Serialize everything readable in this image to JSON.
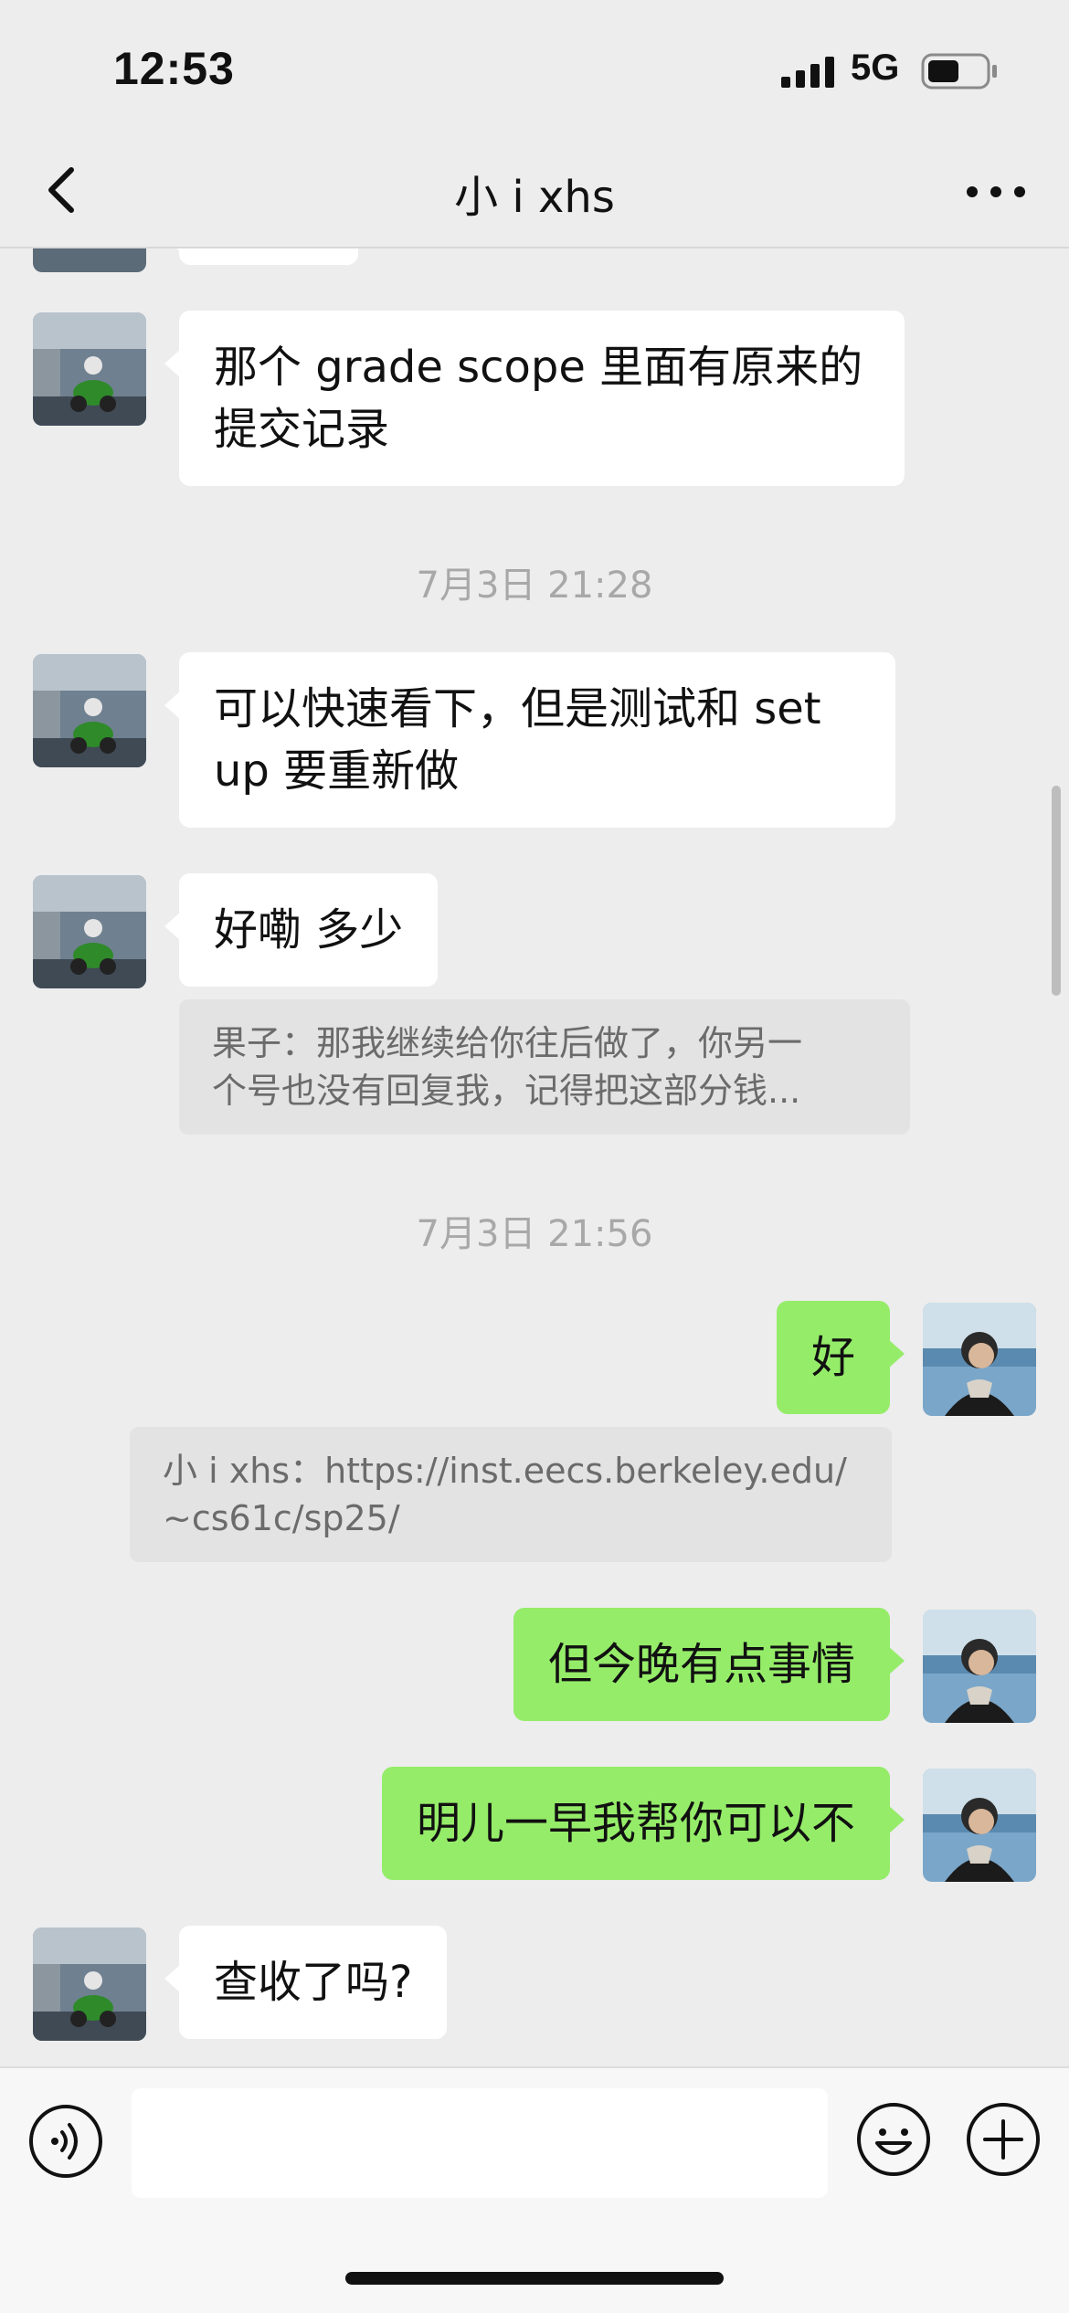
{
  "status_bar": {
    "time": "12:53",
    "network": "5G",
    "battery_level": 0.55
  },
  "nav": {
    "title": "小 i xhs",
    "back_icon": "chevron-left-icon",
    "more_icon": "ellipsis-icon"
  },
  "messages": {
    "m1": "那个 grade scope 里面有原来的\n提交记录",
    "ts1": "7月3日 21:28",
    "m2": "可以快速看下，但是测试和 set\nup 要重新做",
    "m3": "好嘞 多少",
    "q1": "果子：那我继续给你往后做了，你另一\n个号也没有回复我，记得把这部分钱...",
    "ts2": "7月3日 21:56",
    "m4": "好",
    "q2": "小 i xhs：https://inst.eecs.berkeley.edu/\n~cs61c/sp25/",
    "m5": "但今晚有点事情",
    "m6": "明儿一早我帮你可以不",
    "m7": "查收了吗?"
  },
  "input_bar": {
    "voice_icon": "voice-icon",
    "placeholder": "",
    "emoji_icon": "emoji-icon",
    "plus_icon": "plus-icon"
  },
  "colors": {
    "outgoing_bubble": "#95ec69",
    "incoming_bubble": "#ffffff",
    "background": "#ededed"
  }
}
